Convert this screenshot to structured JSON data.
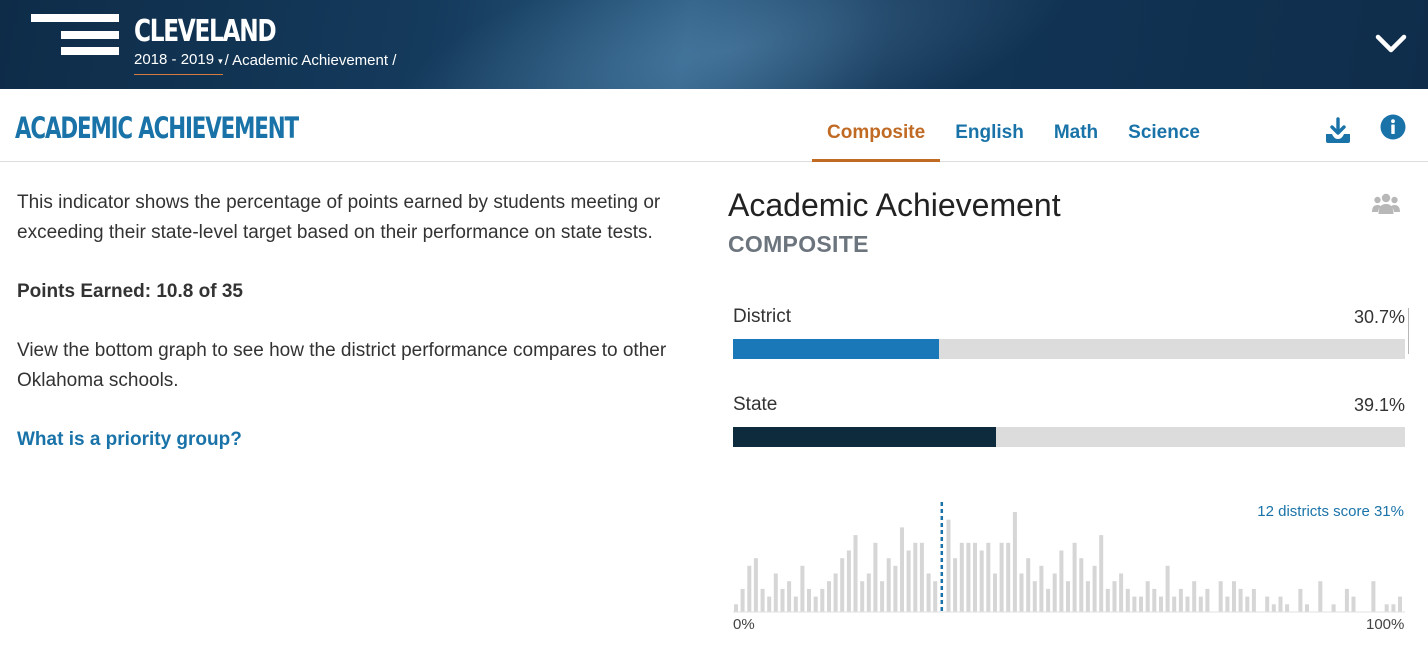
{
  "header": {
    "district_name": "CLEVELAND",
    "year": "2018 - 2019",
    "breadcrumb": "/ Academic Achievement /",
    "menu_icon": "hamburger-logo",
    "expand_icon": "chevron-down-icon"
  },
  "titlebar": {
    "title": "ACADEMIC ACHIEVEMENT",
    "tabs": [
      {
        "label": "Composite",
        "active": true
      },
      {
        "label": "English",
        "active": false
      },
      {
        "label": "Math",
        "active": false
      },
      {
        "label": "Science",
        "active": false
      }
    ],
    "download_icon": "download-icon",
    "info_icon": "info-icon"
  },
  "description": {
    "intro": "This indicator shows the percentage of points earned by students meeting or exceeding their state-level target based on their performance on state tests.",
    "points_earned": "Points Earned: 10.8 of 35",
    "compare_text": "View the bottom graph to see how the district performance compares to other Oklahoma schools.",
    "priority_link": "What is a priority group?"
  },
  "card": {
    "title": "Academic Achievement",
    "subtitle": "COMPOSITE",
    "group_icon": "users-icon"
  },
  "colors": {
    "district": "#1a78b8",
    "state": "#0e2a3d",
    "track": "#dcdcdc",
    "accent": "#c06a24",
    "link": "#1a73a8",
    "hist_bar": "#d6d6d6",
    "marker": "#1a73a8"
  },
  "comparison": [
    {
      "label": "District",
      "value_text": "30.7%",
      "value": 30.7,
      "color_key": "district"
    },
    {
      "label": "State",
      "value_text": "39.1%",
      "value": 39.1,
      "color_key": "state"
    }
  ],
  "chart_data": {
    "type": "bar",
    "title": "",
    "annotation": "12 districts score 31%",
    "x_range": [
      0,
      100
    ],
    "x_tick_labels": [
      "0%",
      "100%"
    ],
    "marker_x": 31,
    "x": [
      0,
      1,
      2,
      3,
      4,
      5,
      6,
      7,
      8,
      9,
      10,
      11,
      12,
      13,
      14,
      15,
      16,
      17,
      18,
      19,
      20,
      21,
      22,
      23,
      24,
      25,
      26,
      27,
      28,
      29,
      30,
      31,
      32,
      33,
      34,
      35,
      36,
      37,
      38,
      39,
      40,
      41,
      42,
      43,
      44,
      45,
      46,
      47,
      48,
      49,
      50,
      51,
      52,
      53,
      54,
      55,
      56,
      57,
      58,
      59,
      60,
      61,
      62,
      63,
      64,
      65,
      66,
      67,
      68,
      69,
      70,
      71,
      72,
      73,
      74,
      75,
      76,
      77,
      78,
      79,
      80,
      81,
      82,
      83,
      84,
      85,
      86,
      87,
      88,
      89,
      90,
      91,
      92,
      93,
      94,
      95,
      96,
      97,
      98,
      99,
      100
    ],
    "values": [
      1,
      3,
      6,
      7,
      3,
      2,
      5,
      3,
      4,
      2,
      6,
      3,
      2,
      3,
      4,
      5,
      7,
      8,
      10,
      4,
      5,
      9,
      4,
      7,
      6,
      11,
      8,
      9,
      9,
      5,
      4,
      0,
      12,
      7,
      9,
      9,
      9,
      8,
      9,
      5,
      9,
      9,
      13,
      5,
      7,
      4,
      6,
      3,
      5,
      8,
      4,
      9,
      7,
      4,
      6,
      10,
      3,
      4,
      5,
      3,
      2,
      2,
      4,
      3,
      2,
      6,
      2,
      3,
      2,
      4,
      2,
      3,
      0,
      4,
      2,
      4,
      3,
      2,
      3,
      0,
      2,
      1,
      2,
      1,
      0,
      3,
      1,
      0,
      4,
      0,
      1,
      0,
      3,
      2,
      0,
      0,
      4,
      0,
      1,
      1,
      2
    ]
  }
}
